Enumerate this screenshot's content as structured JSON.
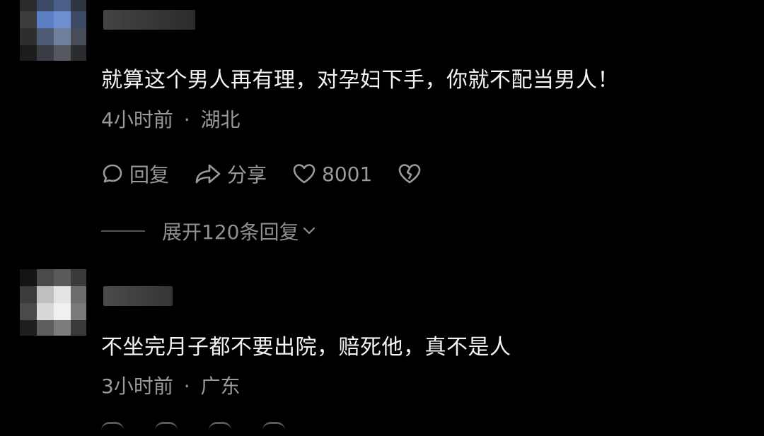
{
  "comments": [
    {
      "text": "就算这个男人再有理，对孕妇下手，你就不配当男人！",
      "time": "4小时前",
      "separator": "·",
      "location": "湖北",
      "actions": {
        "reply_label": "回复",
        "share_label": "分享",
        "like_count": "8001"
      },
      "expand_label": "展开120条回复"
    },
    {
      "text": "不坐完月子都不要出院，赔死他，真不是人",
      "time": "3小时前",
      "separator": "·",
      "location": "广东"
    }
  ],
  "icons": {
    "reply": "comment-bubble-icon",
    "share": "share-arrow-icon",
    "like": "heart-icon",
    "dislike": "broken-heart-icon",
    "expand": "chevron-down-icon"
  },
  "colors": {
    "background": "#000000",
    "text": "#f4f4f4",
    "secondary": "#9a9a9a"
  }
}
